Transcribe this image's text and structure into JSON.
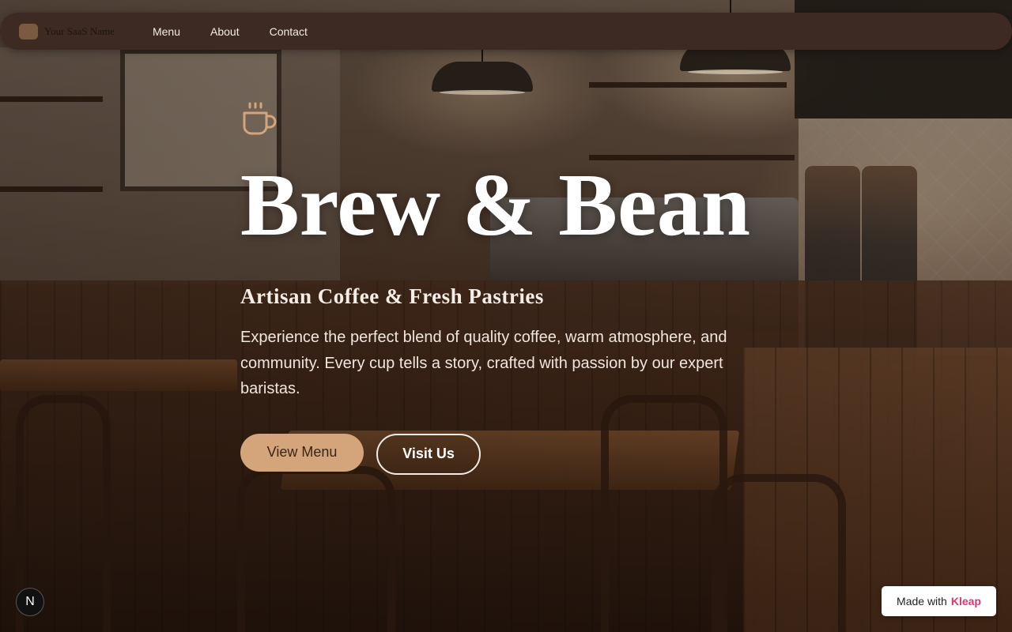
{
  "navbar": {
    "brand_name": "Your SaaS Name",
    "links": [
      {
        "label": "Menu"
      },
      {
        "label": "About"
      },
      {
        "label": "Contact"
      }
    ]
  },
  "hero": {
    "icon": "coffee-cup-icon",
    "title": "Brew & Bean",
    "subtitle": "Artisan Coffee & Fresh Pastries",
    "description": "Experience the perfect blend of quality coffee, warm atmosphere, and community. Every cup tells a story, crafted with passion by our expert baristas.",
    "primary_button": "View Menu",
    "secondary_button": "Visit Us"
  },
  "corner_badge": {
    "letter": "N"
  },
  "made_with": {
    "prefix": "Made with",
    "brand": "Kleap"
  },
  "colors": {
    "navbar_bg": "#3d2a22",
    "accent": "#d4a47a",
    "brand_logo": "#7a5a41",
    "kleap_pink": "#e5336b"
  }
}
